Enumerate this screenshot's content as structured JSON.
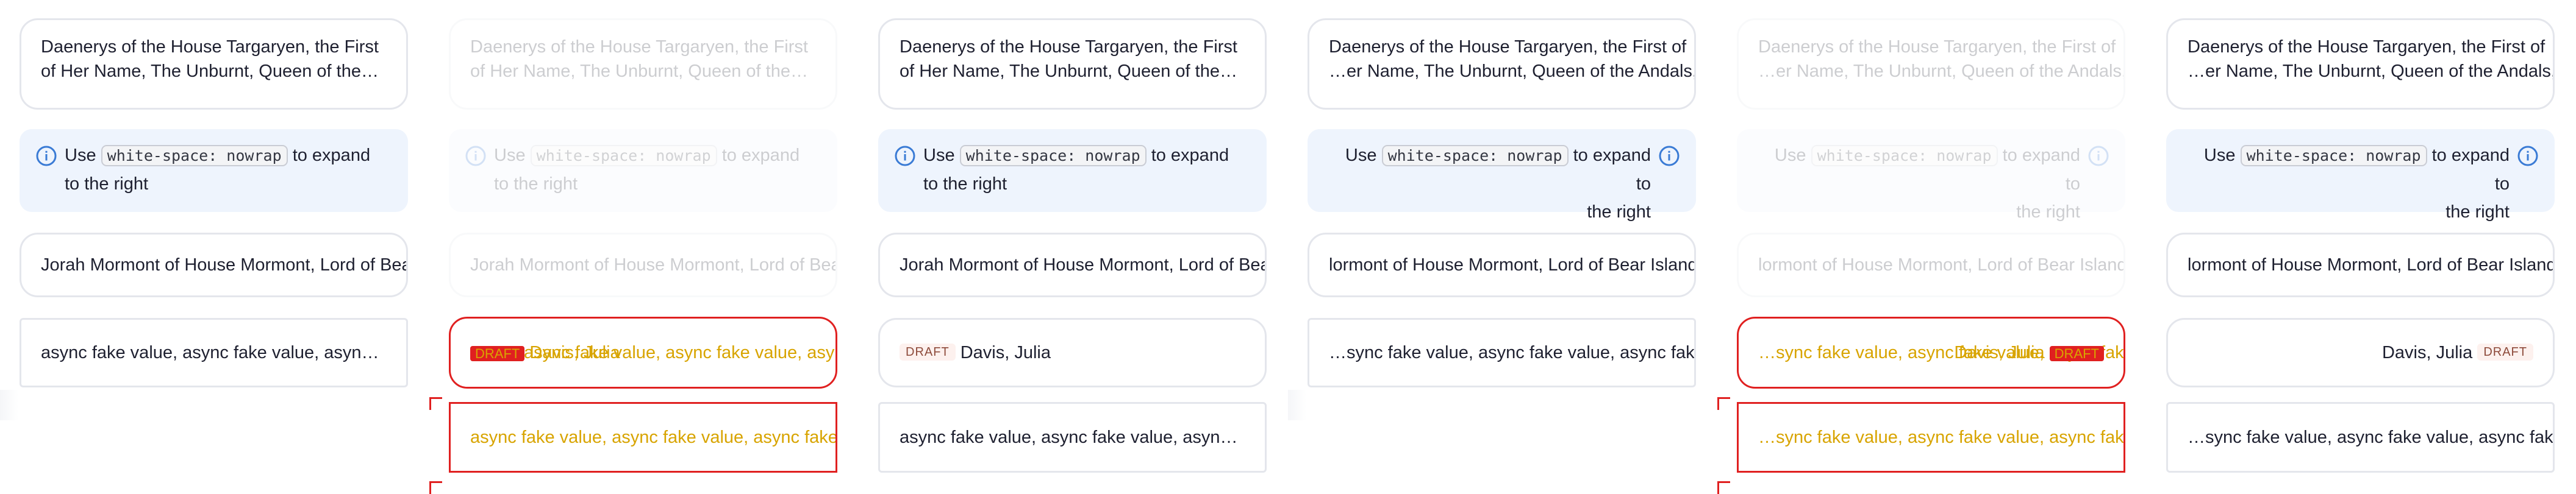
{
  "panels": [
    {
      "long_name": "Daenerys of the House Targaryen, the First of Her Name, The Unburnt, Queen of the Andals, the Rhoynar and the First Men, Khaleesi of the Great Grass Sea",
      "note_pre": "Use",
      "note_code": "white-space: nowrap",
      "note_post": "to expand to the right",
      "row3": "Jorah Mormont of House Mormont, Lord of Bear Island",
      "row4": "async fake value, async fake value, async fake value"
    },
    {
      "long_name": "Daenerys of the House Targaryen, the First of Her Name, The Unburnt, Queen of the Andals, the Rhoynar and the First Men",
      "note_pre": "Use",
      "note_code": "white-space: nowrap",
      "note_post": "to expand to the right",
      "row3": "Jorah Mormont of House Mormont, Lord of Bear Island",
      "overlay_badge": "DRAFT",
      "overlay_name": "Davis, Julia",
      "row4": "async fake value, async fake value, async fake value",
      "row5": "async fake value, async fake value, async fake value"
    },
    {
      "long_name": "Daenerys of the House Targaryen, the First of Her Name, The Unburnt, Queen of the Andals, the Rhoynar and the First Men",
      "note_pre": "Use",
      "note_code": "white-space: nowrap",
      "note_post": "to expand to the right",
      "row3": "Jorah Mormont of House Mormont, Lord of Bear Island",
      "badge": "DRAFT",
      "name": "Davis, Julia",
      "row5": "async fake value, async fake value, async fake value"
    },
    {
      "long_name_l1": "Daenerys of the House Targaryen, the First of",
      "long_name_l2": "…er Name, The Unburnt, Queen of the Andals,",
      "note_pre": "Use",
      "note_code": "white-space: nowrap",
      "note_post": "to expand to",
      "note_post2": "the right",
      "row3": "lormont of House Mormont, Lord of Bear Island",
      "row4": "…sync fake value, async fake value, async fake"
    },
    {
      "long_name_l1": "Daenerys of the House Targaryen, the First of",
      "long_name_l2": "…er Name, The Unburnt, Queen of the Andals,",
      "note_pre": "Use",
      "note_code": "white-space: nowrap",
      "note_post": "to expand to",
      "note_post2": "the right",
      "row3": "lormont of House Mormont, Lord of Bear Island",
      "overlay_badge": "DRAFT",
      "overlay_name": "Davis, Julia",
      "row4": "…sync fake value, async fake value, async fake",
      "row5": "…sync fake value, async fake value, async fake"
    },
    {
      "long_name_l1": "Daenerys of the House Targaryen, the First of",
      "long_name_l2": "…er Name, The Unburnt, Queen of the Andals,",
      "note_pre": "Use",
      "note_code": "white-space: nowrap",
      "note_post": "to expand to",
      "note_post2": "the right",
      "row3": "lormont of House Mormont, Lord of Bear Island",
      "badge": "DRAFT",
      "name": "Davis, Julia",
      "row5": "…sync fake value, async fake value, async fake"
    }
  ]
}
